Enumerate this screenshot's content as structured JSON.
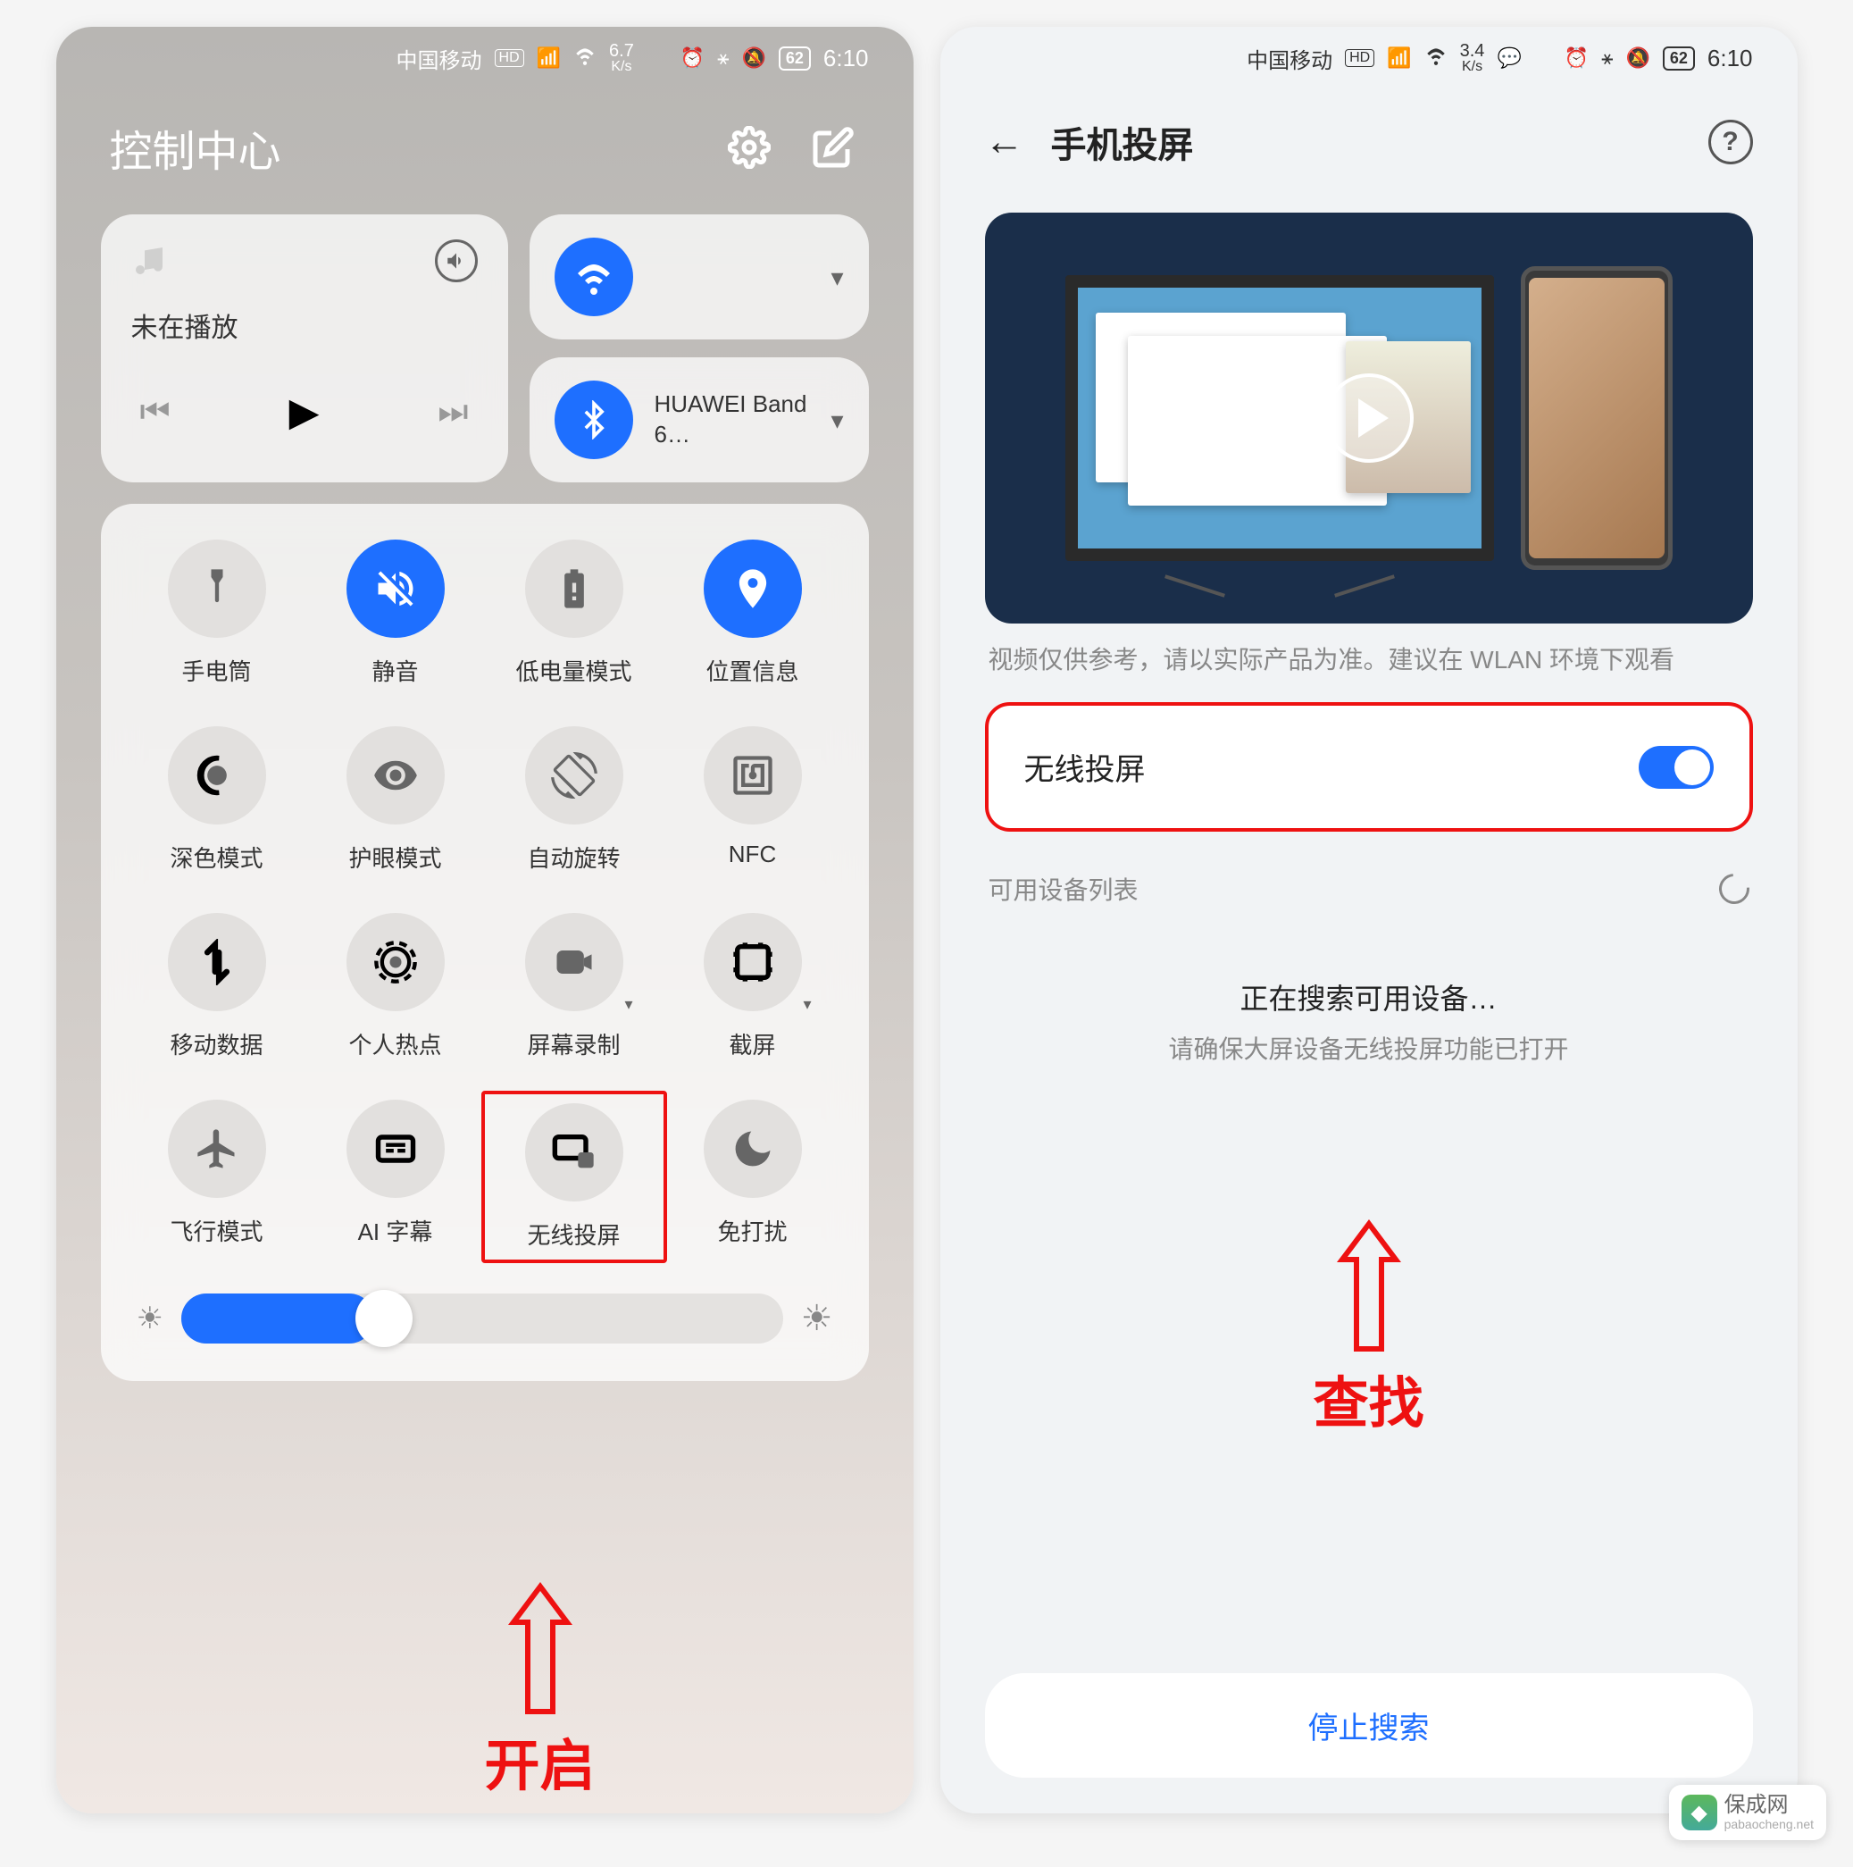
{
  "statusbar": {
    "carrier": "中国移动",
    "net_badge": "HD",
    "signal": "46",
    "speed_val": "6.7",
    "speed_unit": "K/s",
    "speed_val_r": "3.4",
    "battery": "62",
    "time": "6:10"
  },
  "control_center": {
    "title": "控制中心",
    "media": {
      "status": "未在播放"
    },
    "bluetooth": {
      "device": "HUAWEI Band 6…"
    },
    "tiles": [
      {
        "label": "手电筒",
        "on": false,
        "icon": "flashlight"
      },
      {
        "label": "静音",
        "on": true,
        "icon": "mute"
      },
      {
        "label": "低电量模式",
        "on": false,
        "icon": "battery-leaf"
      },
      {
        "label": "位置信息",
        "on": true,
        "icon": "location"
      },
      {
        "label": "深色模式",
        "on": false,
        "icon": "dark-mode"
      },
      {
        "label": "护眼模式",
        "on": false,
        "icon": "eye"
      },
      {
        "label": "自动旋转",
        "on": false,
        "icon": "rotate"
      },
      {
        "label": "NFC",
        "on": false,
        "icon": "nfc"
      },
      {
        "label": "移动数据",
        "on": false,
        "icon": "data"
      },
      {
        "label": "个人热点",
        "on": false,
        "icon": "hotspot"
      },
      {
        "label": "屏幕录制",
        "on": false,
        "icon": "record",
        "expand": true
      },
      {
        "label": "截屏",
        "on": false,
        "icon": "screenshot",
        "expand": true
      },
      {
        "label": "飞行模式",
        "on": false,
        "icon": "airplane"
      },
      {
        "label": "AI 字幕",
        "on": false,
        "icon": "subtitle"
      },
      {
        "label": "无线投屏",
        "on": false,
        "icon": "cast",
        "highlight": true
      },
      {
        "label": "免打扰",
        "on": false,
        "icon": "moon"
      }
    ]
  },
  "annotations": {
    "left": "开启",
    "right": "查找"
  },
  "settings": {
    "page_title": "手机投屏",
    "video_note": "视频仅供参考，请以实际产品为准。建议在 WLAN 环境下观看",
    "toggle_label": "无线投屏",
    "list_header": "可用设备列表",
    "searching_title": "正在搜索可用设备…",
    "searching_sub": "请确保大屏设备无线投屏功能已打开",
    "stop_button": "停止搜索"
  },
  "watermark": {
    "name": "保成网",
    "sub": "pabaocheng.net"
  }
}
